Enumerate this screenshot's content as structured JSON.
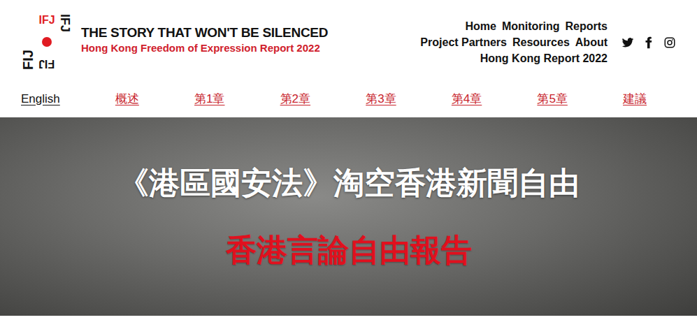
{
  "logo": {
    "top": "IFJ",
    "left": "FIJ",
    "right": "IFJ",
    "bottom": "FIJ"
  },
  "header": {
    "title": "THE STORY THAT WON'T BE SILENCED",
    "subtitle": "Hong Kong Freedom of Expression Report 2022"
  },
  "nav": [
    [
      "Home",
      "Monitoring",
      "Reports"
    ],
    [
      "Project Partners",
      "Resources",
      "About"
    ],
    [
      "Hong Kong Report 2022"
    ]
  ],
  "languages": [
    {
      "label": "English",
      "kind": "language"
    },
    {
      "label": "概述",
      "kind": "chapter"
    },
    {
      "label": "第1章",
      "kind": "chapter"
    },
    {
      "label": "第2章",
      "kind": "chapter"
    },
    {
      "label": "第3章",
      "kind": "chapter"
    },
    {
      "label": "第4章",
      "kind": "chapter"
    },
    {
      "label": "第5章",
      "kind": "chapter"
    },
    {
      "label": "建議",
      "kind": "chapter"
    }
  ],
  "hero": {
    "title": "《港區國安法》淘空香港新聞自由",
    "subtitle": "香港言論自由報告"
  }
}
